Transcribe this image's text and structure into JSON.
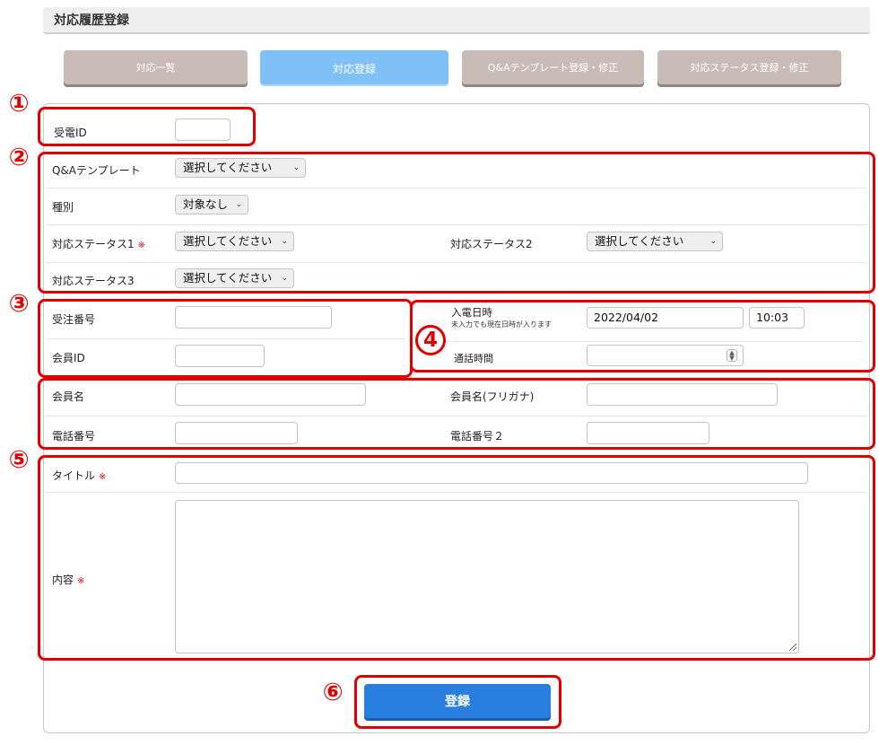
{
  "page_title": "対応履歴登録",
  "tabs": [
    {
      "label": "対応一覧",
      "active": false
    },
    {
      "label": "対応登録",
      "active": true
    },
    {
      "label": "Q&Aテンプレート登録・修正",
      "active": false
    },
    {
      "label": "対応ステータス登録・修正",
      "active": false
    }
  ],
  "required_mark": "※",
  "fields": {
    "reception_id": {
      "label": "受電ID",
      "value": ""
    },
    "qa_template": {
      "label": "Q&Aテンプレート",
      "selected": "選択してください"
    },
    "category": {
      "label": "種別",
      "selected": "対象なし"
    },
    "status1": {
      "label": "対応ステータス1",
      "selected": "選択してください"
    },
    "status2": {
      "label": "対応ステータス2",
      "selected": "選択してください"
    },
    "status3": {
      "label": "対応ステータス3",
      "selected": "選択してください"
    },
    "order_number": {
      "label": "受注番号",
      "value": ""
    },
    "member_id": {
      "label": "会員ID",
      "value": ""
    },
    "member_name": {
      "label": "会員名",
      "value": ""
    },
    "member_name_kana": {
      "label": "会員名(フリガナ)",
      "value": ""
    },
    "phone": {
      "label": "電話番号",
      "value": ""
    },
    "phone2": {
      "label": "電話番号２",
      "value": ""
    },
    "call_datetime": {
      "label": "入電日時",
      "note": "未入力でも現在日時が入ります",
      "date": "2022/04/02",
      "time": "10:03"
    },
    "call_duration": {
      "label": "通話時間",
      "value": ""
    },
    "title": {
      "label": "タイトル",
      "value": ""
    },
    "content": {
      "label": "内容",
      "value": ""
    }
  },
  "annotations": [
    "①",
    "②",
    "③",
    "4",
    "⑤",
    "⑥"
  ],
  "submit_label": "登録",
  "colors": {
    "annotation_red": "#e00000",
    "submit_blue": "#2a7ee0",
    "tab_active": "#7fc1f7",
    "tab_inactive": "#c9bcb6"
  }
}
